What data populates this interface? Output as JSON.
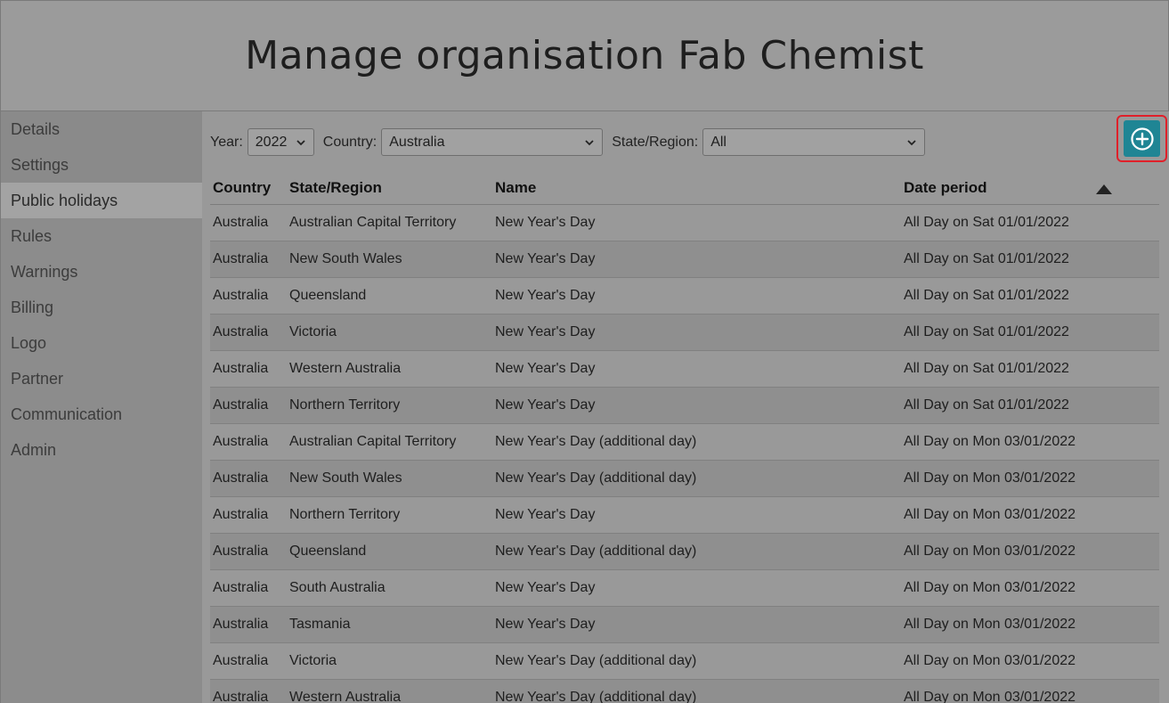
{
  "page": {
    "title": "Manage organisation Fab Chemist"
  },
  "sidebar": {
    "items": [
      {
        "label": "Details"
      },
      {
        "label": "Settings"
      },
      {
        "label": "Public holidays"
      },
      {
        "label": "Rules"
      },
      {
        "label": "Warnings"
      },
      {
        "label": "Billing"
      },
      {
        "label": "Logo"
      },
      {
        "label": "Partner"
      },
      {
        "label": "Communication"
      },
      {
        "label": "Admin"
      }
    ]
  },
  "filters": {
    "year_label": "Year:",
    "year_value": "2022",
    "country_label": "Country:",
    "country_value": "Australia",
    "state_label": "State/Region:",
    "state_value": "All"
  },
  "add_button": {
    "icon": "plus-circle-icon"
  },
  "table": {
    "headers": {
      "country": "Country",
      "state": "State/Region",
      "name": "Name",
      "date": "Date period"
    },
    "sort": {
      "column": "Date period",
      "icon": "sort-ascending-icon"
    },
    "rows": [
      {
        "country": "Australia",
        "state": "Australian Capital Territory",
        "name": "New Year's Day",
        "date": "All Day on Sat 01/01/2022"
      },
      {
        "country": "Australia",
        "state": "New South Wales",
        "name": "New Year's Day",
        "date": "All Day on Sat 01/01/2022"
      },
      {
        "country": "Australia",
        "state": "Queensland",
        "name": "New Year's Day",
        "date": "All Day on Sat 01/01/2022"
      },
      {
        "country": "Australia",
        "state": "Victoria",
        "name": "New Year's Day",
        "date": "All Day on Sat 01/01/2022"
      },
      {
        "country": "Australia",
        "state": "Western Australia",
        "name": "New Year's Day",
        "date": "All Day on Sat 01/01/2022"
      },
      {
        "country": "Australia",
        "state": "Northern Territory",
        "name": "New Year's Day",
        "date": "All Day on Sat 01/01/2022"
      },
      {
        "country": "Australia",
        "state": "Australian Capital Territory",
        "name": "New Year's Day (additional day)",
        "date": "All Day on Mon 03/01/2022"
      },
      {
        "country": "Australia",
        "state": "New South Wales",
        "name": "New Year's Day (additional day)",
        "date": "All Day on Mon 03/01/2022"
      },
      {
        "country": "Australia",
        "state": "Northern Territory",
        "name": "New Year's Day",
        "date": "All Day on Mon 03/01/2022"
      },
      {
        "country": "Australia",
        "state": "Queensland",
        "name": "New Year's Day (additional day)",
        "date": "All Day on Mon 03/01/2022"
      },
      {
        "country": "Australia",
        "state": "South Australia",
        "name": "New Year's Day",
        "date": "All Day on Mon 03/01/2022"
      },
      {
        "country": "Australia",
        "state": "Tasmania",
        "name": "New Year's Day",
        "date": "All Day on Mon 03/01/2022"
      },
      {
        "country": "Australia",
        "state": "Victoria",
        "name": "New Year's Day (additional day)",
        "date": "All Day on Mon 03/01/2022"
      },
      {
        "country": "Australia",
        "state": "Western Australia",
        "name": "New Year's Day (additional day)",
        "date": "All Day on Mon 03/01/2022"
      }
    ]
  }
}
